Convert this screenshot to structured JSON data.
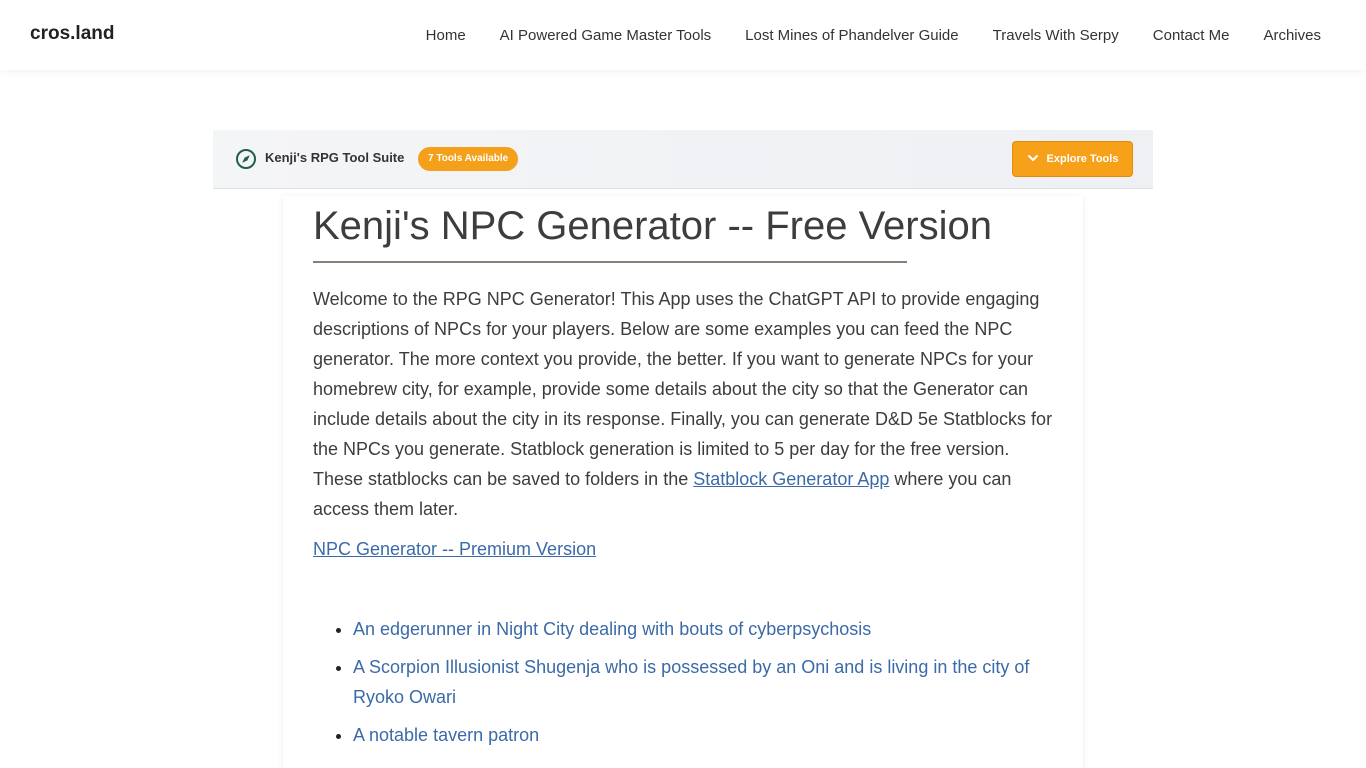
{
  "header": {
    "brand": "cros.land",
    "nav": [
      {
        "label": "Home"
      },
      {
        "label": "AI Powered Game Master Tools"
      },
      {
        "label": "Lost Mines of Phandelver Guide"
      },
      {
        "label": "Travels With Serpy"
      },
      {
        "label": "Contact Me"
      },
      {
        "label": "Archives"
      }
    ]
  },
  "toolbar": {
    "icon": "compass-icon",
    "title": "Kenji's RPG Tool Suite",
    "badge": "7 Tools Available",
    "explore_label": "Explore Tools",
    "explore_icon": "chevron-down-icon",
    "accent": "#f7a01a"
  },
  "main": {
    "title": "Kenji's NPC Generator -- Free Version",
    "intro_text": "Welcome to the RPG NPC Generator! This App uses the ChatGPT API to provide engaging descriptions of NPCs for your players. Below are some examples you can feed the NPC generator. The more context you provide, the better. If you want to generate NPCs for your homebrew city, for example, provide some details about the city so that the Generator can include details about the city in its response. Finally, you can generate D&D 5e Statblocks for the NPCs you generate. Statblock generation is limited to 5 per day for the free version. These statblocks can be saved to folders in the",
    "statblock_link": "Statblock Generator App",
    "intro_tail": " where you can access them later.",
    "premium_link": "NPC Generator -- Premium Version",
    "examples": [
      "An edgerunner in Night City dealing with bouts of cyberpsychosis",
      "A Scorpion Illusionist Shugenja who is possessed by an Oni and is living in the city of Ryoko Owari",
      "A notable tavern patron"
    ]
  }
}
